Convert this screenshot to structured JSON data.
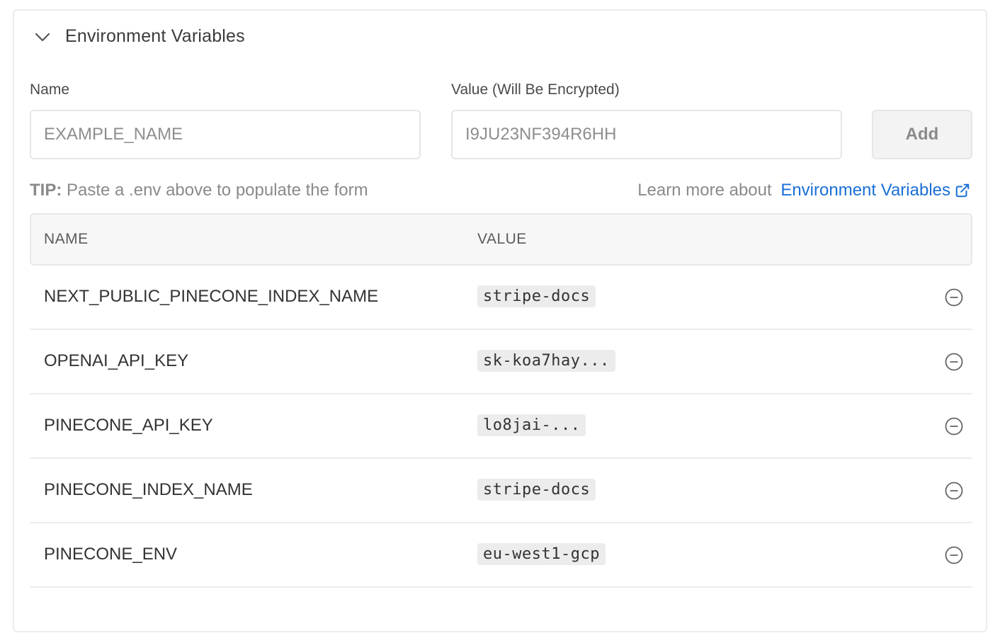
{
  "section": {
    "title": "Environment Variables",
    "toggle_icon": "chevron-down-icon"
  },
  "form": {
    "name_label": "Name",
    "name_placeholder": "EXAMPLE_NAME",
    "value_label": "Value (Will Be Encrypted)",
    "value_placeholder": "I9JU23NF394R6HH",
    "add_label": "Add"
  },
  "tip": {
    "prefix": "TIP:",
    "text": " Paste a .env above to populate the form"
  },
  "learn_more": {
    "text": "Learn more about ",
    "link": "Environment Variables",
    "icon": "external-link-icon",
    "link_color": "#1a6fd6"
  },
  "table": {
    "headers": [
      "NAME",
      "VALUE"
    ],
    "rows": [
      {
        "name": "NEXT_PUBLIC_PINECONE_INDEX_NAME",
        "value": "stripe-docs"
      },
      {
        "name": "OPENAI_API_KEY",
        "value": "sk-koa7hay..."
      },
      {
        "name": "PINECONE_API_KEY",
        "value": "lo8jai-..."
      },
      {
        "name": "PINECONE_INDEX_NAME",
        "value": "stripe-docs"
      },
      {
        "name": "PINECONE_ENV",
        "value": "eu-west1-gcp"
      }
    ],
    "remove_icon": "minus-circle-icon"
  }
}
